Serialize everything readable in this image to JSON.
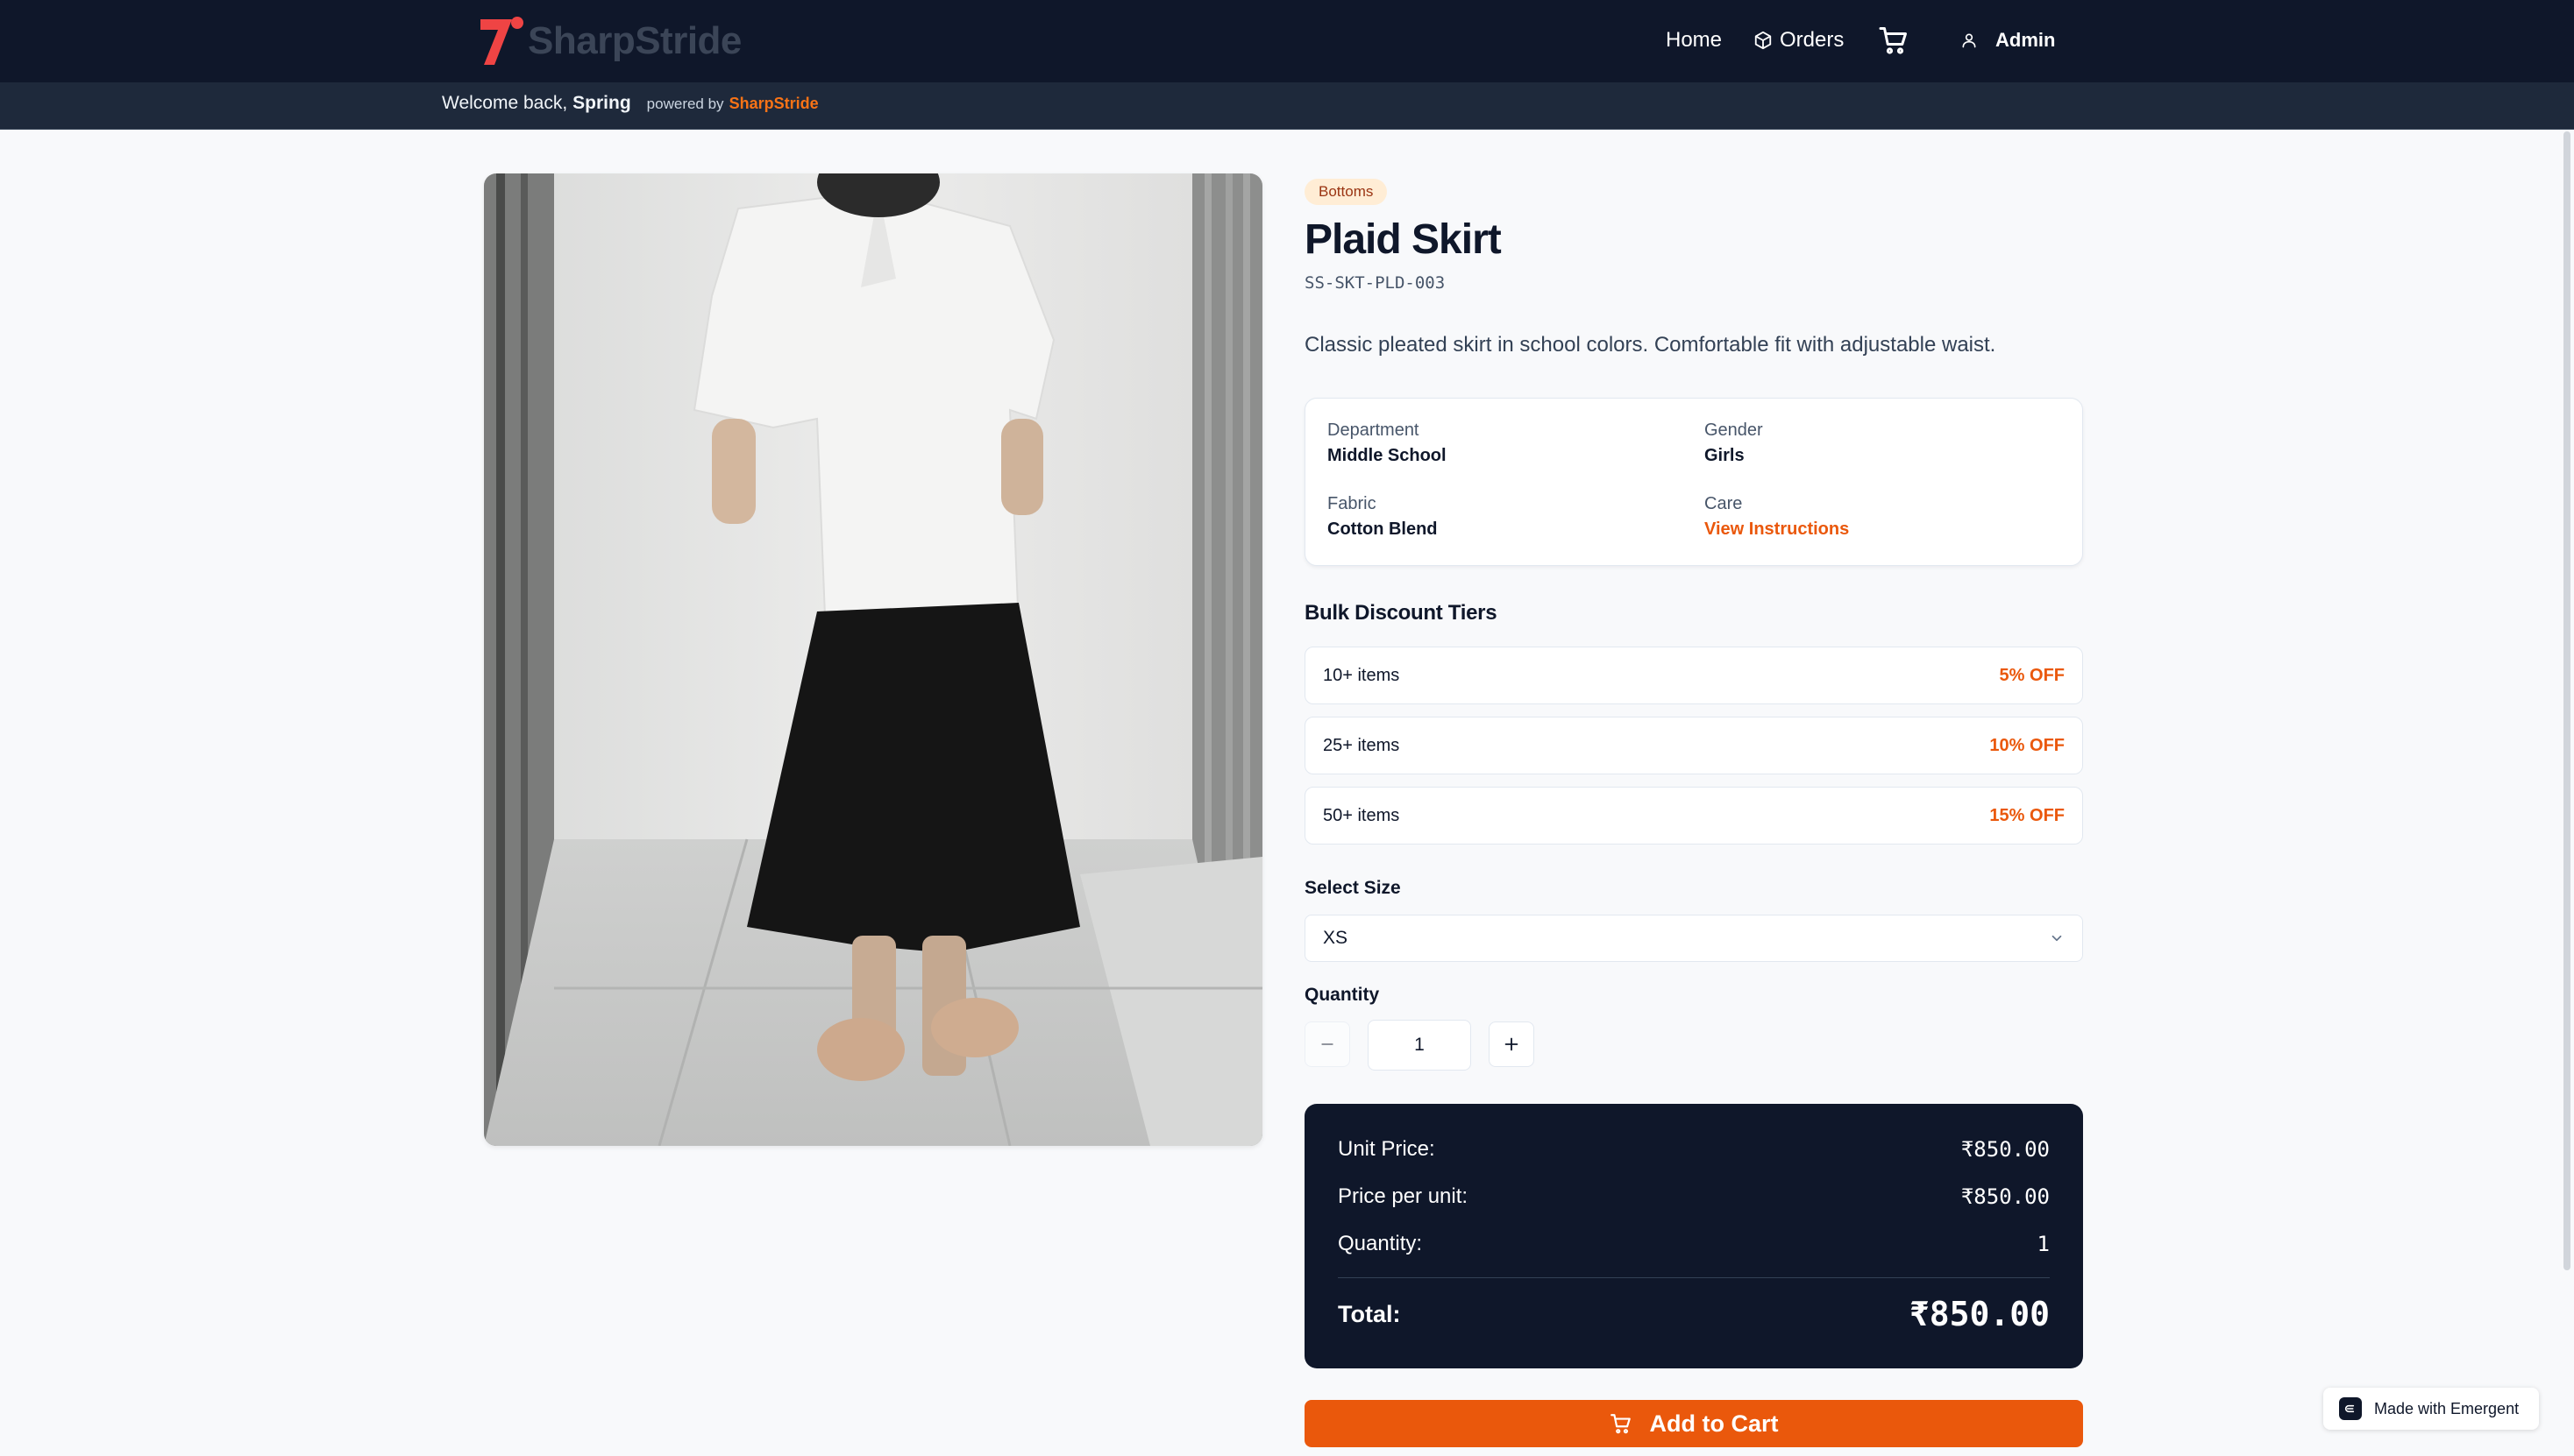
{
  "header": {
    "brand": "SharpStride",
    "nav": {
      "home": "Home",
      "orders": "Orders",
      "admin": "Admin"
    }
  },
  "subbar": {
    "welcome_prefix": "Welcome back,",
    "user_name": "Spring",
    "powered_by": "powered by",
    "powered_brand": "SharpStride"
  },
  "product": {
    "category": "Bottoms",
    "name": "Plaid Skirt",
    "sku": "SS-SKT-PLD-003",
    "description": "Classic pleated skirt in school colors. Comfortable fit with adjustable waist.",
    "details": {
      "department_label": "Department",
      "department_value": "Middle School",
      "gender_label": "Gender",
      "gender_value": "Girls",
      "fabric_label": "Fabric",
      "fabric_value": "Cotton Blend",
      "care_label": "Care",
      "care_value": "View Instructions"
    }
  },
  "discounts": {
    "title": "Bulk Discount Tiers",
    "tiers": [
      {
        "qty": "10+ items",
        "off": "5% OFF"
      },
      {
        "qty": "25+ items",
        "off": "10% OFF"
      },
      {
        "qty": "50+ items",
        "off": "15% OFF"
      }
    ]
  },
  "size": {
    "label": "Select Size",
    "selected": "XS"
  },
  "quantity": {
    "label": "Quantity",
    "value": "1"
  },
  "summary": {
    "unit_price_label": "Unit Price:",
    "unit_price_value": "₹850.00",
    "price_per_unit_label": "Price per unit:",
    "price_per_unit_value": "₹850.00",
    "quantity_label": "Quantity:",
    "quantity_value": "1",
    "total_label": "Total:",
    "total_value": "₹850.00"
  },
  "cart_button": {
    "label": "Add to Cart"
  },
  "badge_made": {
    "label": "Made with Emergent"
  },
  "colors": {
    "navy": "#0f172a",
    "accent": "#ea580c",
    "badge_bg": "#ffedd5"
  }
}
